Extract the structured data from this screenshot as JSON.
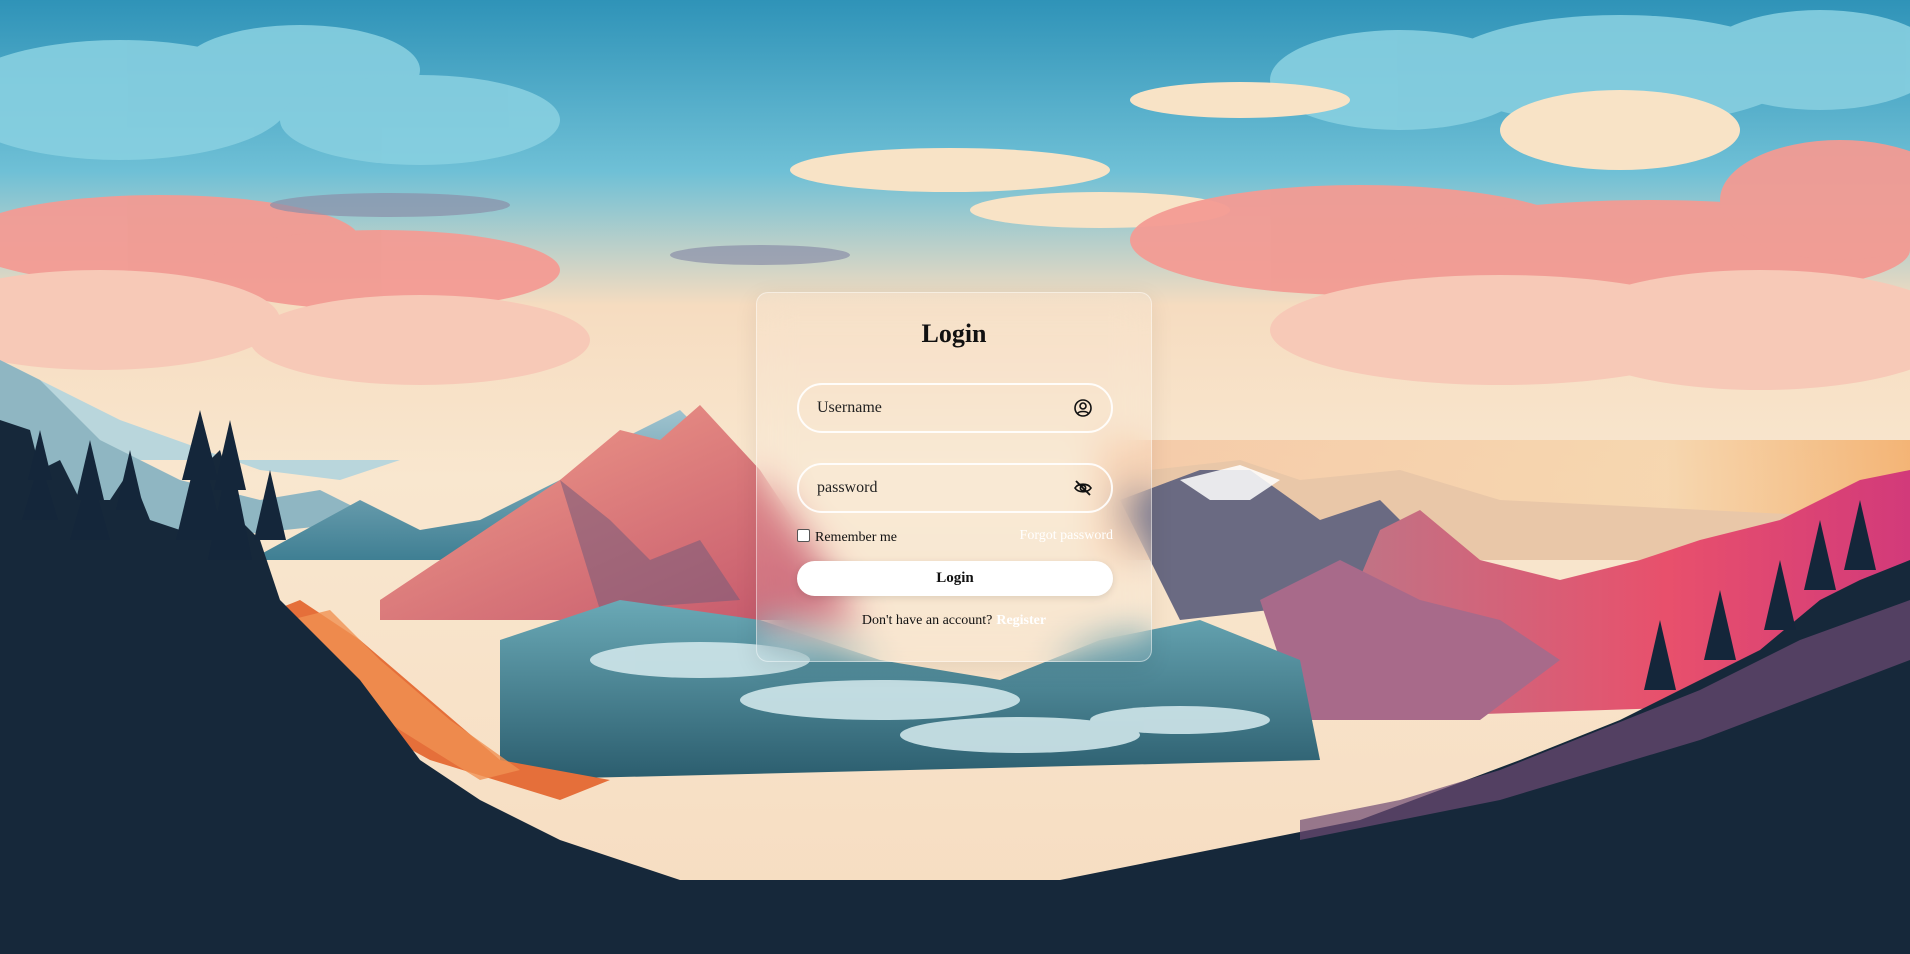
{
  "background": {
    "description_colors": [
      "#3a9ec1",
      "#f7c9a8",
      "#e86c74",
      "#1b2a3a"
    ]
  },
  "login": {
    "title": "Login",
    "username_placeholder": "Username",
    "username_icon": "user-circle-icon",
    "password_placeholder": "password",
    "password_icon": "eye-off-icon",
    "remember_label": "Remember me",
    "forgot_label": "Forgot password",
    "submit_label": "Login",
    "no_account_text": "Don't have an account?",
    "register_label": "Register"
  }
}
